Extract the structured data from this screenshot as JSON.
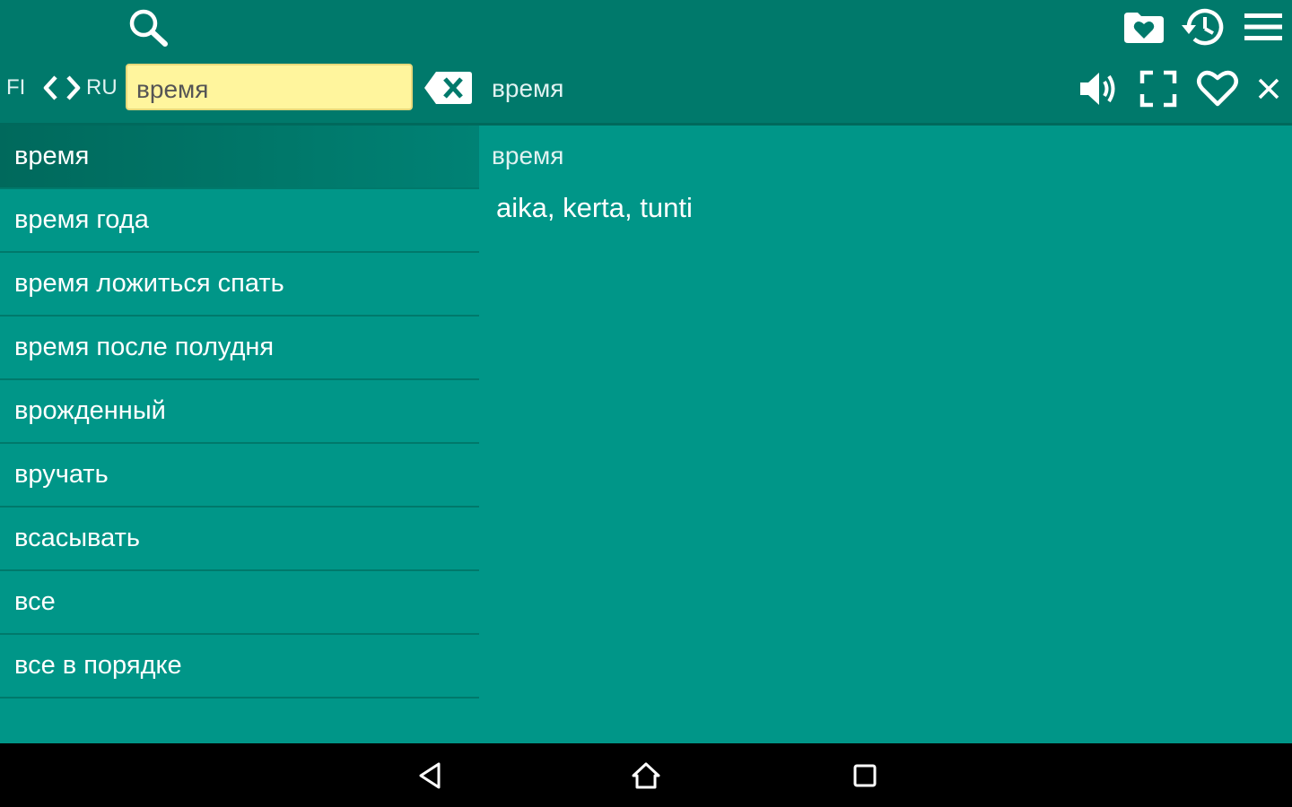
{
  "colors": {
    "accent": "#009688",
    "toolbar": "#00796b",
    "selected_row": "#00695c",
    "search_field": "#fff59d",
    "navbar": "#000000"
  },
  "toolbar": {
    "icons": [
      "search-icon",
      "favorites-folder-icon",
      "history-icon",
      "menu-icon"
    ]
  },
  "language_bar": {
    "source_lang": "FI",
    "target_lang": "RU",
    "swap_icon": "chevron-left-right-icon"
  },
  "search": {
    "value": "время"
  },
  "detail_header": {
    "word": "время",
    "icons": [
      "speaker-icon",
      "fullscreen-icon",
      "heart-icon",
      "close-icon"
    ]
  },
  "word_list": {
    "selected_index": 0,
    "items": [
      "время",
      "время года",
      "время ложиться спать",
      "время после полудня",
      "врожденный",
      "вручать",
      "всасывать",
      "все",
      "все в порядке"
    ]
  },
  "entry": {
    "headword": "время",
    "translation": "aika, kerta, tunti"
  },
  "navbar": {
    "icons": [
      "back-icon",
      "home-icon",
      "recent-apps-icon"
    ]
  }
}
